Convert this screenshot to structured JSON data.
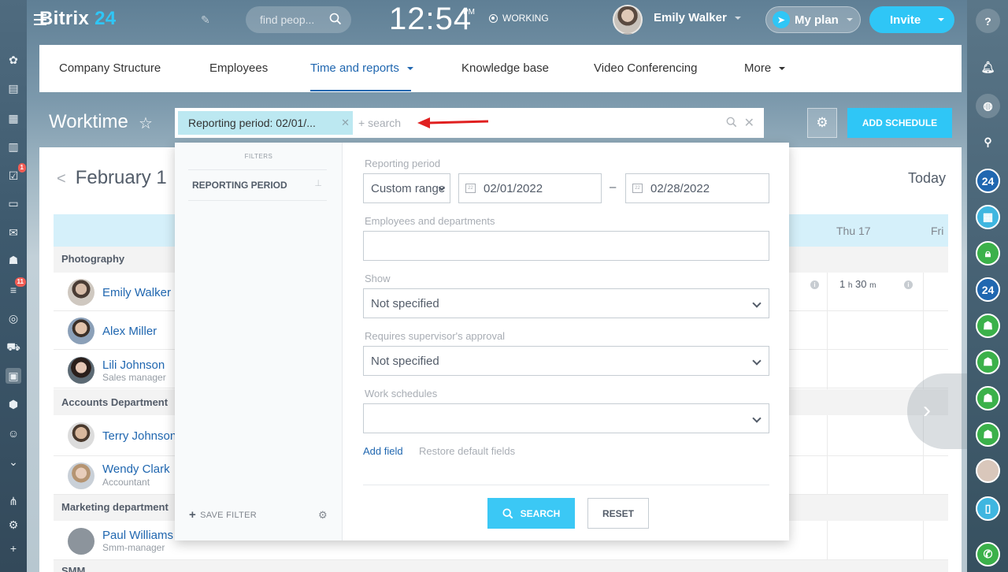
{
  "header": {
    "logo_text": "Bitrix",
    "logo_num": "24",
    "search_placeholder": "find peop...",
    "clock": "12:54",
    "clock_suffix": "PM",
    "status": "WORKING",
    "user_name": "Emily Walker",
    "myplan_label": "My plan",
    "invite_label": "Invite"
  },
  "nav": {
    "items": [
      "Company Structure",
      "Employees",
      "Time and reports",
      "Knowledge base",
      "Video Conferencing",
      "More"
    ],
    "active": "Time and reports"
  },
  "toolbar": {
    "title": "Worktime",
    "filter_chip": "Reporting period: 02/01/...",
    "search_placeholder": "+ search",
    "add_schedule_label": "ADD SCHEDULE"
  },
  "calendar": {
    "month_label": "February 1",
    "today_label": "Today",
    "day_headers": [
      "Thu 17",
      "Fri"
    ],
    "time_value_h": "1",
    "time_value_h_unit": "h",
    "time_value_m": "30",
    "time_value_m_unit": "m",
    "info_glyph": "i"
  },
  "groups": [
    {
      "name": "Photography"
    },
    {
      "name": "Accounts Department"
    },
    {
      "name": "Marketing department"
    },
    {
      "name": "SMM"
    }
  ],
  "employees": [
    {
      "name": "Emily Walker",
      "role": ""
    },
    {
      "name": "Alex Miller",
      "role": ""
    },
    {
      "name": "Lili Johnson",
      "role": "Sales manager"
    },
    {
      "name": "Terry Johnson",
      "role": ""
    },
    {
      "name": "Wendy Clark",
      "role": "Accountant"
    },
    {
      "name": "Paul Williams",
      "role": "Smm-manager"
    }
  ],
  "filter_popup": {
    "filters_heading": "FILTERS",
    "preset": "REPORTING PERIOD",
    "save_filter_label": "SAVE FILTER",
    "fields": {
      "period_label": "Reporting period",
      "period_type": "Custom range",
      "date_from": "02/01/2022",
      "date_to": "02/28/2022",
      "date_separator": "–",
      "employees_label": "Employees and departments",
      "employees_value": "",
      "show_label": "Show",
      "show_value": "Not specified",
      "approval_label": "Requires supervisor's approval",
      "approval_value": "Not specified",
      "schedules_label": "Work schedules",
      "schedules_value": ""
    },
    "add_field_label": "Add field",
    "restore_label": "Restore default fields",
    "search_button": "SEARCH",
    "reset_button": "RESET"
  },
  "badges": {
    "tasks": "1",
    "feed": "11"
  },
  "right_bar": {
    "b24_label": "24"
  },
  "colors": {
    "accent": "#2fc6f6",
    "link": "#2067b0",
    "badge": "#f25c54",
    "arrow": "#e02020"
  }
}
